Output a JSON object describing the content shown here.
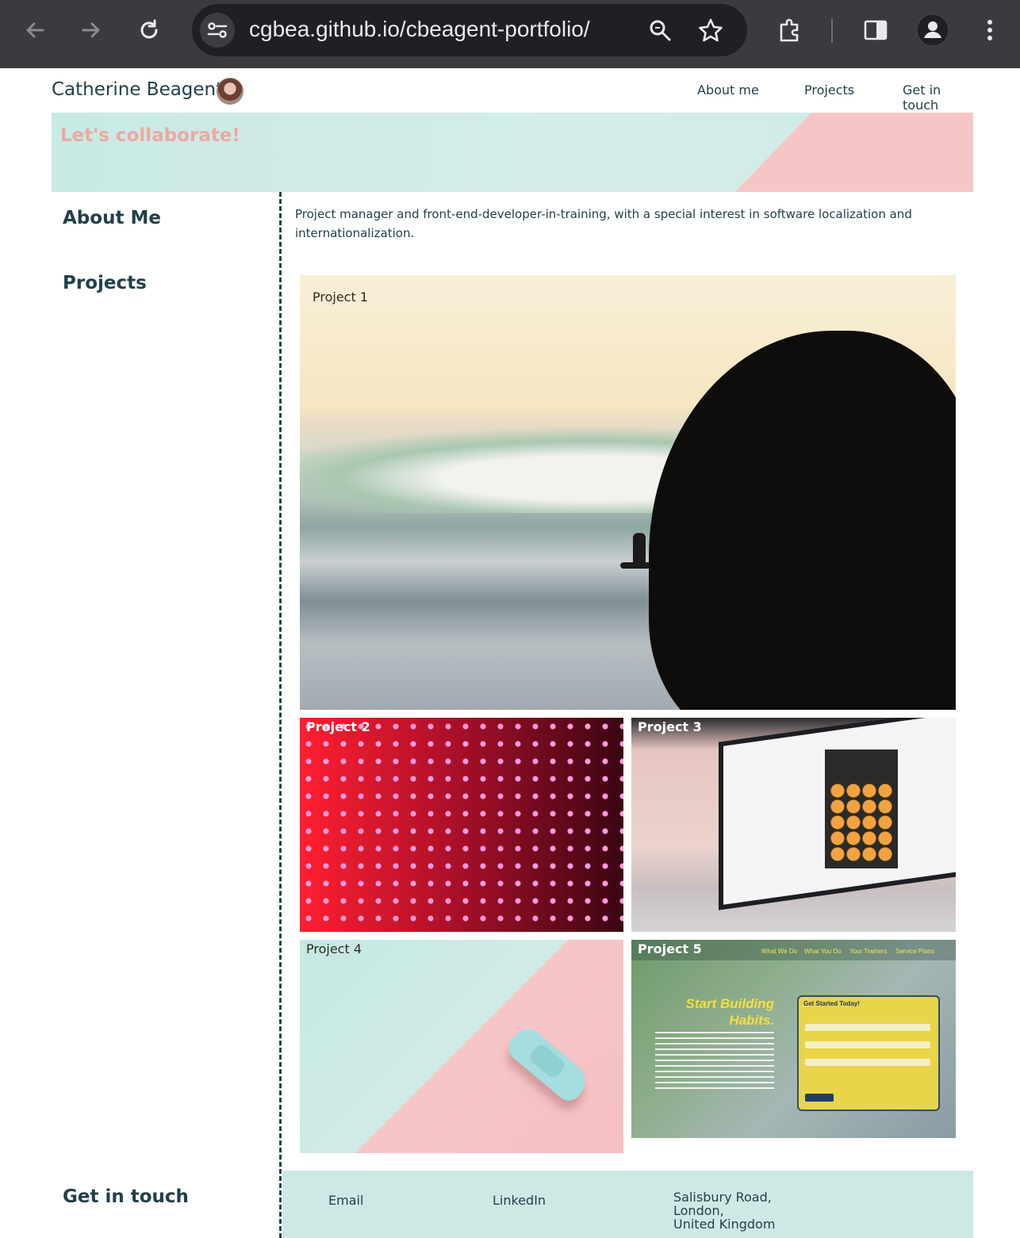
{
  "browser": {
    "url": "cgbea.github.io/cbeagent-portfolio/"
  },
  "site": {
    "name": "Catherine Beagent",
    "nav": [
      "About me",
      "Projects",
      "Get in touch"
    ]
  },
  "hero": {
    "title": "Let's collaborate!"
  },
  "sidebar": {
    "about": "About Me",
    "projects": "Projects",
    "contact": "Get in touch"
  },
  "about": {
    "text": "Project manager and front-end-developer-in-training, with a special interest in software localization and internationalization."
  },
  "projects": [
    {
      "label": "Project 1"
    },
    {
      "label": "Project 2"
    },
    {
      "label": "Project 3"
    },
    {
      "label": "Project 4"
    },
    {
      "label": "Project 5"
    }
  ],
  "project5_screenshot": {
    "nav": [
      "What We Do",
      "What You Do",
      "Your Trainers",
      "Service Plans"
    ],
    "headline_1": "Start Building",
    "headline_2": "Habits.",
    "form_title": "Get Started Today!"
  },
  "footer": {
    "email": "Email",
    "linkedin": "LinkedIn",
    "address_1": "Salisbury Road,",
    "address_2": "London,",
    "address_3": "United Kingdom"
  },
  "colors": {
    "text": "#22404a",
    "hero_mint": "#c8e9e4",
    "hero_pink": "#f6c6c6",
    "hero_title": "#eda8a2",
    "footer_bg": "#cce9e5"
  }
}
